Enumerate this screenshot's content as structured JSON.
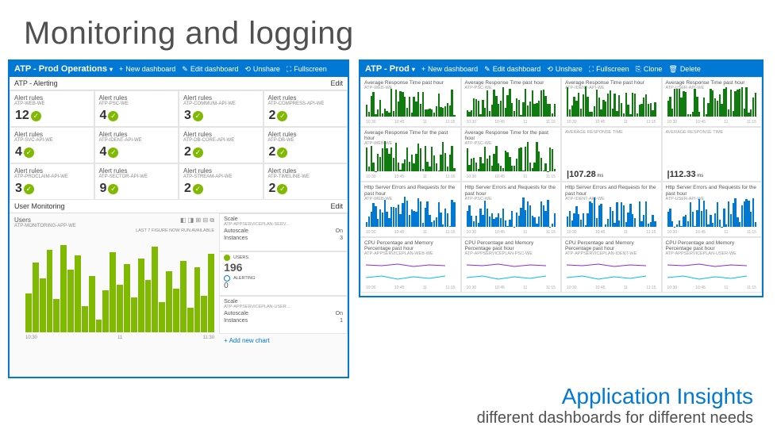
{
  "slide": {
    "title": "Monitoring and logging",
    "app_insights": "Application Insights",
    "tagline": "different dashboards for different needs"
  },
  "dash_left": {
    "name": "ATP - Prod Operations",
    "actions": {
      "new": "New dashboard",
      "edit": "Edit dashboard",
      "share": "Unshare",
      "full": "Fullscreen"
    },
    "section_alert": {
      "title": "ATP - Alerting",
      "action": "Edit"
    },
    "alerts": [
      {
        "label": "Alert rules",
        "sub": "ATP-WEB-WE",
        "count": 12
      },
      {
        "label": "Alert rules",
        "sub": "ATP-PSC-WE",
        "count": 4
      },
      {
        "label": "Alert rules",
        "sub": "ATP-COMMUNI-API-WE",
        "count": 3
      },
      {
        "label": "Alert rules",
        "sub": "ATP-COMPRESS-API-WE",
        "count": 2
      },
      {
        "label": "Alert rules",
        "sub": "ATP-SVC-API-WE",
        "count": 4
      },
      {
        "label": "Alert rules",
        "sub": "ATP-IDENT-API-WE",
        "count": 4
      },
      {
        "label": "Alert rules",
        "sub": "ATP-DB-CORE-API-WE",
        "count": 2
      },
      {
        "label": "Alert rules",
        "sub": "ATP-DB-WE",
        "count": 2
      },
      {
        "label": "Alert rules",
        "sub": "ATP-PROCLAIM-API-WE",
        "count": 3
      },
      {
        "label": "Alert rules",
        "sub": "ATP-SECTOR-API-WE",
        "count": 9
      },
      {
        "label": "Alert rules",
        "sub": "ATP-STREAM-API-WE",
        "count": 2
      },
      {
        "label": "Alert rules",
        "sub": "ATP-TIMELINE-WE",
        "count": 2
      }
    ],
    "section_user": {
      "title": "User Monitoring",
      "action": "Edit"
    },
    "users_tile": {
      "label": "Users",
      "sub": "ATP-MONITORING-APP-WE",
      "footer": "LAST 7 FIGURE NOW RUN AVAILABLE"
    },
    "users_xaxis": [
      "10:30",
      "11",
      "11:30"
    ],
    "users_stat": {
      "label": "USERS",
      "value": "196",
      "alert_label": "ALERTING",
      "alert_value": "0"
    },
    "add_chart": "Add new chart",
    "scale1": {
      "title": "Scale",
      "sub": "ATP-APPSERVICEPLAN-SERV...",
      "autoscale_label": "Autoscale",
      "autoscale_value": "On",
      "instances_label": "Instances",
      "instances_value": "3"
    },
    "scale2": {
      "title": "Scale",
      "sub": "ATP-APPSERVICEPLAN-USER...",
      "autoscale_label": "Autoscale",
      "autoscale_value": "On",
      "instances_label": "Instances",
      "instances_value": "1"
    }
  },
  "dash_right": {
    "name": "ATP - Prod",
    "actions": {
      "new": "New dashboard",
      "edit": "Edit dashboard",
      "unshare": "Unshare",
      "full": "Fullscreen",
      "clone": "Clone",
      "delete": "Delete"
    },
    "tiles": [
      {
        "title": "Average Response Time past hour",
        "sub": "ATP-WEB-WE"
      },
      {
        "title": "Average Response Time past hour",
        "sub": "ATP-PSC-WE"
      },
      {
        "title": "Average Response Time past hour",
        "sub": "ATP-IDENT-API-WE"
      },
      {
        "title": "Average Response Time past hour",
        "sub": "ATP-USER-API-WE"
      },
      {
        "title": "Average Response Time for the past hour",
        "sub": "ATP-WEB-WE"
      },
      {
        "title": "Average Response Time for the past hour",
        "sub": "ATP-PSC-WE"
      },
      {
        "title": "",
        "sub": "AVERAGE RESPONSE TIME",
        "big": "107.28",
        "unit": "ms"
      },
      {
        "title": "",
        "sub": "AVERAGE RESPONSE TIME",
        "big": "112.33",
        "unit": "ms"
      },
      {
        "title": "Http Server Errors and Requests for the past hour",
        "sub": "ATP-WEB-WE"
      },
      {
        "title": "Http Server Errors and Requests for the past hour",
        "sub": "ATP-PSC-WE"
      },
      {
        "title": "Http Server Errors and Requests for the past hour",
        "sub": "ATP-IDENT-API-WE"
      },
      {
        "title": "Http Server Errors and Requests for the past hour",
        "sub": "ATP-USER-API-WE"
      },
      {
        "title": "CPU Percentage and Memory Percentage past hour",
        "sub": "ATP-APPSERVICEPLAN-WEB-WE"
      },
      {
        "title": "CPU Percentage and Memory Percentage past hour",
        "sub": "ATP-APPSERVICEPLAN-PSC-WE"
      },
      {
        "title": "CPU Percentage and Memory Percentage past hour",
        "sub": "ATP-APPSERVICEPLAN-IDENT-WE"
      },
      {
        "title": "CPU Percentage and Memory Percentage past hour",
        "sub": "ATP-APPSERVICEPLAN-USER-WE"
      }
    ],
    "xaxis": [
      "10:30",
      "10:45",
      "11",
      "11:15"
    ]
  },
  "chart_data": {
    "type": "bar",
    "title": "Users",
    "categories": [
      "10:30",
      "",
      "",
      "",
      "",
      "",
      "",
      "",
      "",
      "",
      "11",
      "",
      "",
      "",
      "",
      "",
      "",
      "",
      "",
      "",
      "11:30"
    ],
    "values": [
      45,
      80,
      62,
      95,
      38,
      100,
      72,
      88,
      30,
      65,
      15,
      48,
      92,
      55,
      78,
      40,
      85,
      60,
      98,
      35,
      70,
      50,
      82,
      28,
      75,
      42,
      90
    ],
    "ylim": [
      0,
      100
    ]
  }
}
